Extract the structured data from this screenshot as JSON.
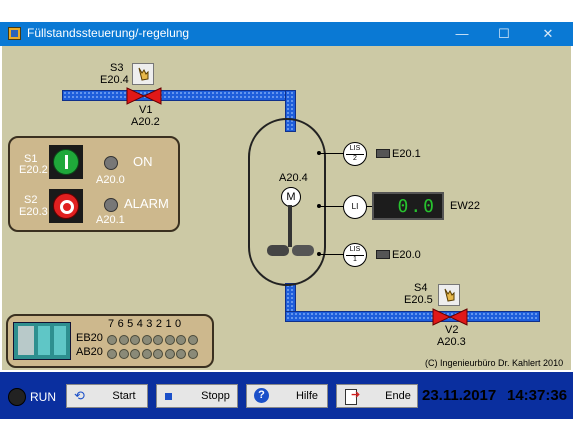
{
  "window": {
    "title": "Füllstandssteuerung/-regelung",
    "minimize": "—",
    "maximize": "☐",
    "close": "✕"
  },
  "valve_v1": {
    "switch": "S3",
    "switch_addr": "E20.4",
    "name": "V1",
    "addr": "A20.2"
  },
  "valve_v2": {
    "switch": "S4",
    "switch_addr": "E20.5",
    "name": "V2",
    "addr": "A20.3"
  },
  "control_panel": {
    "s1": "S1",
    "s1_addr": "E20.2",
    "s2": "S2",
    "s2_addr": "E20.3",
    "on_label": "ON",
    "on_addr": "A20.0",
    "alarm_label": "ALARM",
    "alarm_addr": "A20.1"
  },
  "tank": {
    "motor": "M",
    "motor_addr": "A20.4"
  },
  "sensors": [
    {
      "top": "LIS",
      "bottom": "2",
      "addr": "E20.1"
    },
    {
      "top": "LI",
      "bottom": "",
      "addr": ""
    },
    {
      "top": "LIS",
      "bottom": "1",
      "addr": "E20.0"
    }
  ],
  "display": {
    "value": "0.0",
    "label": "EW22"
  },
  "plc": {
    "bits": "7 6 5 4 3 2 1 0",
    "eb": "EB20",
    "ab": "AB20"
  },
  "copyright": "(C) Ingenieurbüro Dr. Kahlert 2010",
  "statusbar": {
    "run": "RUN",
    "start": "Start",
    "stop": "Stopp",
    "help": "Hilfe",
    "end": "Ende",
    "date": "23.11.2017",
    "time": "14:37:36"
  },
  "colors": {
    "pipe": "#1e5edb",
    "panel": "#cdb88d",
    "background": "#ccc9a5",
    "status_bar": "#0a2f9f"
  }
}
